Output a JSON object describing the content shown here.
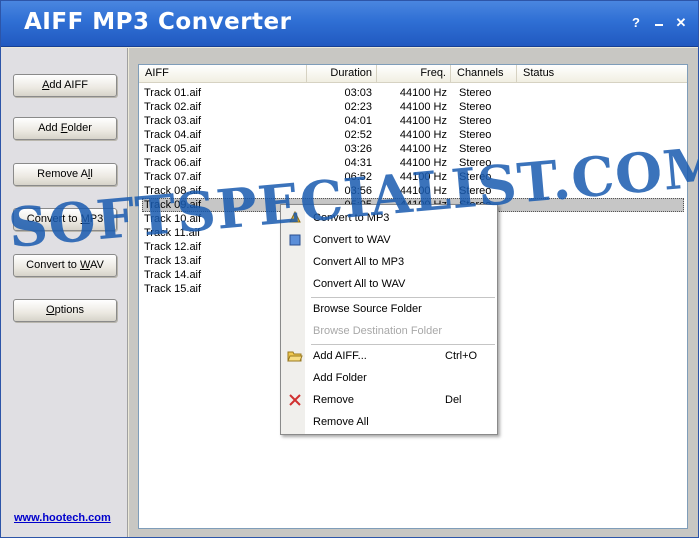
{
  "window": {
    "title": "AIFF MP3 Converter",
    "help_glyph": "?",
    "close_glyph": "✕"
  },
  "sidebar": {
    "buttons": [
      {
        "pre": "",
        "key": "A",
        "post": "dd AIFF"
      },
      {
        "pre": "Add ",
        "key": "F",
        "post": "older"
      },
      {
        "pre": "Remove A",
        "key": "l",
        "post": "l"
      },
      {
        "pre": "Convert to ",
        "key": "M",
        "post": "P3"
      },
      {
        "pre": "Convert to ",
        "key": "W",
        "post": "AV"
      },
      {
        "pre": "",
        "key": "O",
        "post": "ptions"
      }
    ],
    "link": "www.hootech.com"
  },
  "list": {
    "columns": [
      "AIFF",
      "Duration",
      "Freq.",
      "Channels",
      "Status"
    ],
    "rows": [
      {
        "name": "Track 01.aif",
        "duration": "03:03",
        "freq": "44100 Hz",
        "channels": "Stereo"
      },
      {
        "name": "Track 02.aif",
        "duration": "02:23",
        "freq": "44100 Hz",
        "channels": "Stereo"
      },
      {
        "name": "Track 03.aif",
        "duration": "04:01",
        "freq": "44100 Hz",
        "channels": "Stereo"
      },
      {
        "name": "Track 04.aif",
        "duration": "02:52",
        "freq": "44100 Hz",
        "channels": "Stereo"
      },
      {
        "name": "Track 05.aif",
        "duration": "03:26",
        "freq": "44100 Hz",
        "channels": "Stereo"
      },
      {
        "name": "Track 06.aif",
        "duration": "04:31",
        "freq": "44100 Hz",
        "channels": "Stereo"
      },
      {
        "name": "Track 07.aif",
        "duration": "06:52",
        "freq": "44100 Hz",
        "channels": "Stereo"
      },
      {
        "name": "Track 08.aif",
        "duration": "03:56",
        "freq": "44100 Hz",
        "channels": "Stereo"
      },
      {
        "name": "Track 09.aif",
        "duration": "05:05",
        "freq": "44100 Hz",
        "channels": "Stereo"
      },
      {
        "name": "Track 10.aif",
        "duration": "",
        "freq": "",
        "channels": ""
      },
      {
        "name": "Track 11.aif",
        "duration": "",
        "freq": "",
        "channels": ""
      },
      {
        "name": "Track 12.aif",
        "duration": "",
        "freq": "",
        "channels": ""
      },
      {
        "name": "Track 13.aif",
        "duration": "",
        "freq": "",
        "channels": ""
      },
      {
        "name": "Track 14.aif",
        "duration": "",
        "freq": "",
        "channels": ""
      },
      {
        "name": "Track 15.aif",
        "duration": "",
        "freq": "",
        "channels": ""
      }
    ],
    "selected_index": 8
  },
  "context_menu": {
    "items": [
      {
        "label": "Convert to MP3",
        "icon": "convert-mp3-icon"
      },
      {
        "label": "Convert to WAV",
        "icon": "convert-wav-icon"
      },
      {
        "label": "Convert All to MP3"
      },
      {
        "label": "Convert All to WAV"
      },
      {
        "separator": true
      },
      {
        "label": "Browse Source Folder"
      },
      {
        "label": "Browse Destination Folder",
        "disabled": true
      },
      {
        "separator": true
      },
      {
        "label": "Add AIFF...",
        "shortcut": "Ctrl+O",
        "icon": "open-folder-icon"
      },
      {
        "label": "Add Folder"
      },
      {
        "label": "Remove",
        "shortcut": "Del",
        "icon": "remove-x-icon"
      },
      {
        "label": "Remove All"
      }
    ]
  },
  "watermark": "SOFTSPECIALIST.COM",
  "colors": {
    "titlebar": "#2f6fd4",
    "sidebar_bg": "#e0dfe3",
    "selection": "#c6c6c6",
    "link": "#0000cc",
    "watermark": "#195aaf"
  }
}
